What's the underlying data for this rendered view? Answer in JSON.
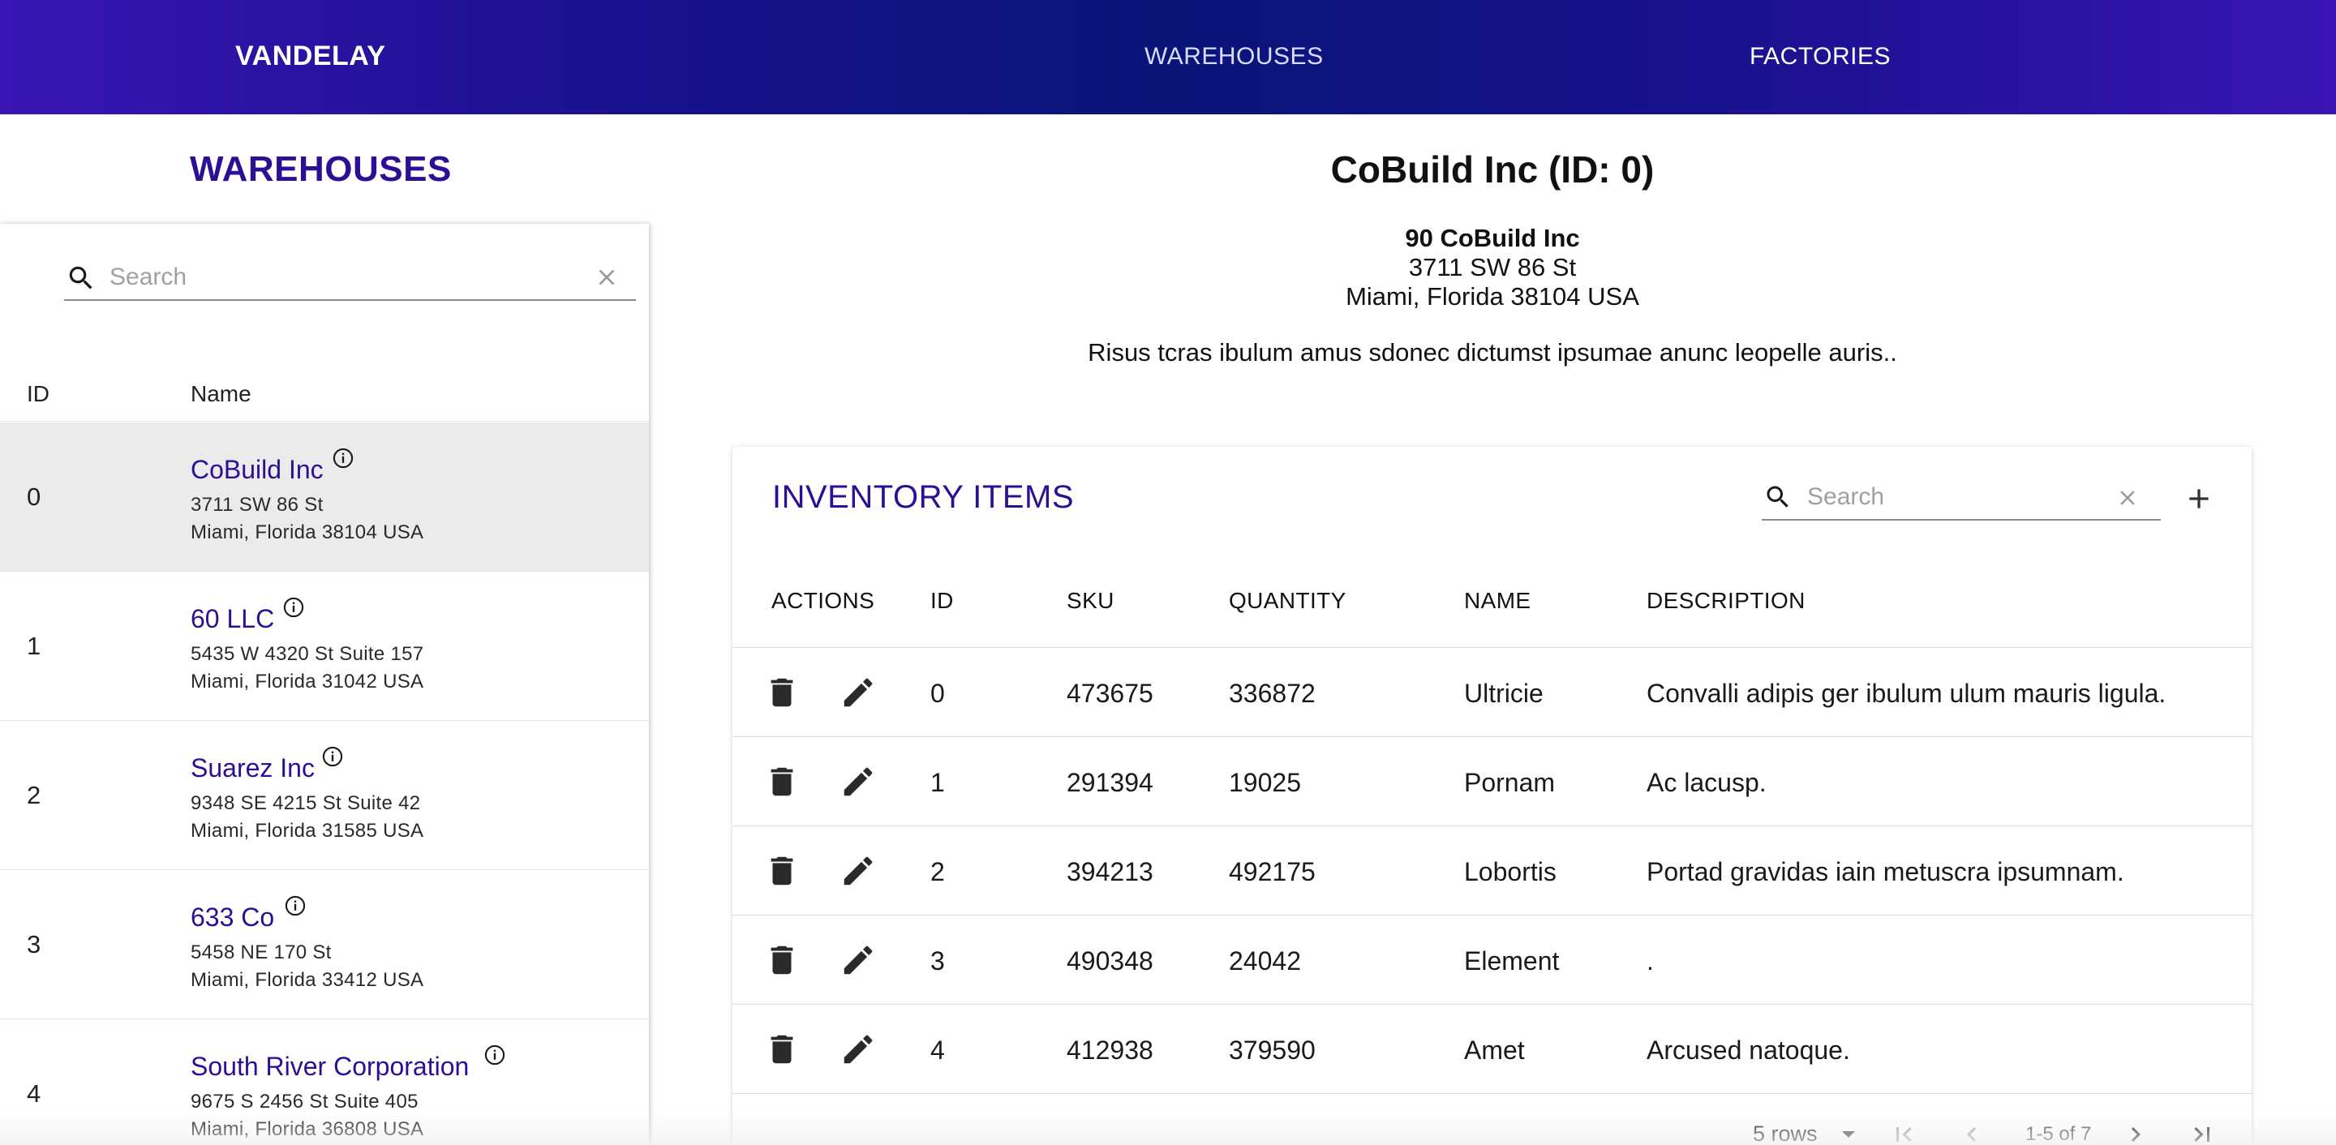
{
  "nav": {
    "brand": "VANDELAY",
    "links": [
      {
        "label": "WAREHOUSES",
        "active": true
      },
      {
        "label": "FACTORIES",
        "active": false
      }
    ]
  },
  "warehouses_panel": {
    "title": "WAREHOUSES",
    "search_placeholder": "Search",
    "columns": {
      "id": "ID",
      "name": "Name"
    },
    "rows": [
      {
        "id": "0",
        "name": "CoBuild Inc",
        "address1": "3711 SW 86 St",
        "address2": "Miami, Florida 38104 USA",
        "selected": true
      },
      {
        "id": "1",
        "name": "60 LLC",
        "address1": "5435 W 4320 St Suite 157",
        "address2": "Miami, Florida 31042 USA",
        "selected": false
      },
      {
        "id": "2",
        "name": "Suarez Inc",
        "address1": "9348 SE 4215 St Suite 42",
        "address2": "Miami, Florida 31585 USA",
        "selected": false
      },
      {
        "id": "3",
        "name": "633 Co",
        "address1": "5458 NE 170 St",
        "address2": "Miami, Florida 33412 USA",
        "selected": false
      },
      {
        "id": "4",
        "name": "South River Corporation",
        "address1": "9675 S 2456 St Suite 405",
        "address2": "Miami, Florida 36808 USA",
        "selected": false
      }
    ]
  },
  "detail": {
    "title": "CoBuild Inc (ID: 0)",
    "address_name": "90 CoBuild Inc",
    "address_line1": "3711 SW 86 St",
    "address_line2": "Miami, Florida 38104 USA",
    "description": "Risus tcras ibulum amus sdonec dictumst ipsumae anunc leopelle auris.."
  },
  "inventory": {
    "title": "INVENTORY ITEMS",
    "search_placeholder": "Search",
    "columns": {
      "actions": "ACTIONS",
      "id": "ID",
      "sku": "SKU",
      "quantity": "QUANTITY",
      "name": "NAME",
      "description": "DESCRIPTION"
    },
    "rows": [
      {
        "id": "0",
        "sku": "473675",
        "quantity": "336872",
        "name": "Ultricie",
        "description": "Convalli adipis ger ibulum ulum mauris ligula."
      },
      {
        "id": "1",
        "sku": "291394",
        "quantity": "19025",
        "name": "Pornam",
        "description": "Ac lacusp."
      },
      {
        "id": "2",
        "sku": "394213",
        "quantity": "492175",
        "name": "Lobortis",
        "description": "Portad gravidas iain metuscra ipsumnam."
      },
      {
        "id": "3",
        "sku": "490348",
        "quantity": "24042",
        "name": "Element",
        "description": "."
      },
      {
        "id": "4",
        "sku": "412938",
        "quantity": "379590",
        "name": "Amet",
        "description": "Arcused natoque."
      }
    ],
    "pagination": {
      "rows_per_page": "5 rows",
      "range": "1-5 of 7"
    }
  },
  "colors": {
    "accent": "#2d0f96",
    "nav_gradient_edge": "#3a14b5",
    "nav_gradient_center": "#0a1478",
    "selected_row": "#ebebeb"
  },
  "icons": {
    "search": "search-icon",
    "clear": "close-icon",
    "info": "info-icon",
    "delete": "trash-icon",
    "edit": "pencil-icon",
    "add": "plus-icon",
    "first_page": "first-page-icon",
    "prev_page": "chevron-left-icon",
    "next_page": "chevron-right-icon",
    "last_page": "last-page-icon"
  }
}
